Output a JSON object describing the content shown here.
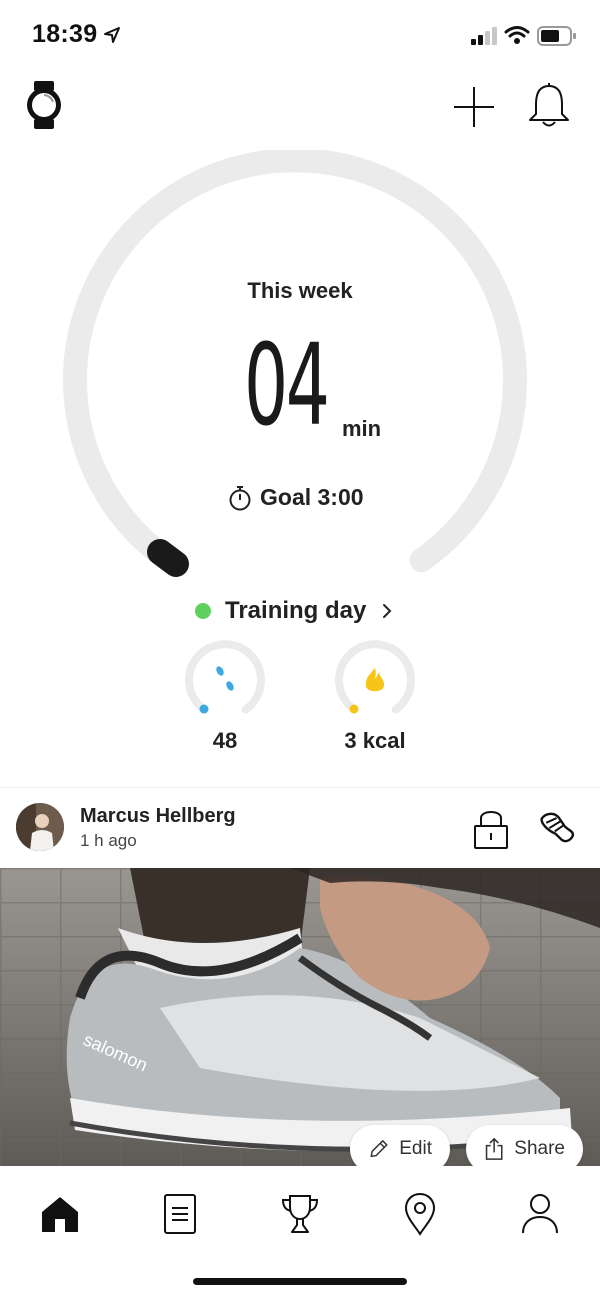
{
  "status_bar": {
    "time": "18:39",
    "icons": [
      "location-arrow-icon",
      "signal-icon",
      "wifi-icon",
      "battery-icon"
    ]
  },
  "header": {
    "icons": [
      "watch-icon",
      "plus-icon",
      "bell-icon"
    ]
  },
  "weekly": {
    "title": "This week",
    "value": "04",
    "unit": "min",
    "goal_label": "Goal 3:00",
    "progress": 0.0
  },
  "training": {
    "label": "Training day"
  },
  "stats": [
    {
      "name": "steps",
      "icon": "steps-icon",
      "value": "48",
      "accent": "#3da9e0"
    },
    {
      "name": "calories",
      "icon": "flame-icon",
      "value": "3 kcal",
      "accent": "#f5c518"
    }
  ],
  "post": {
    "author": "Marcus Hellberg",
    "time": "1 h ago",
    "edit_label": "Edit",
    "share_label": "Share",
    "image_brand": "salomon"
  },
  "tabs": [
    "home-icon",
    "diary-icon",
    "trophy-icon",
    "map-pin-icon",
    "profile-icon"
  ],
  "colors": {
    "training_dot": "#5ed05e",
    "ring": "#ebebeb",
    "accent_blue": "#3da9e0",
    "accent_yellow": "#f5c518"
  }
}
